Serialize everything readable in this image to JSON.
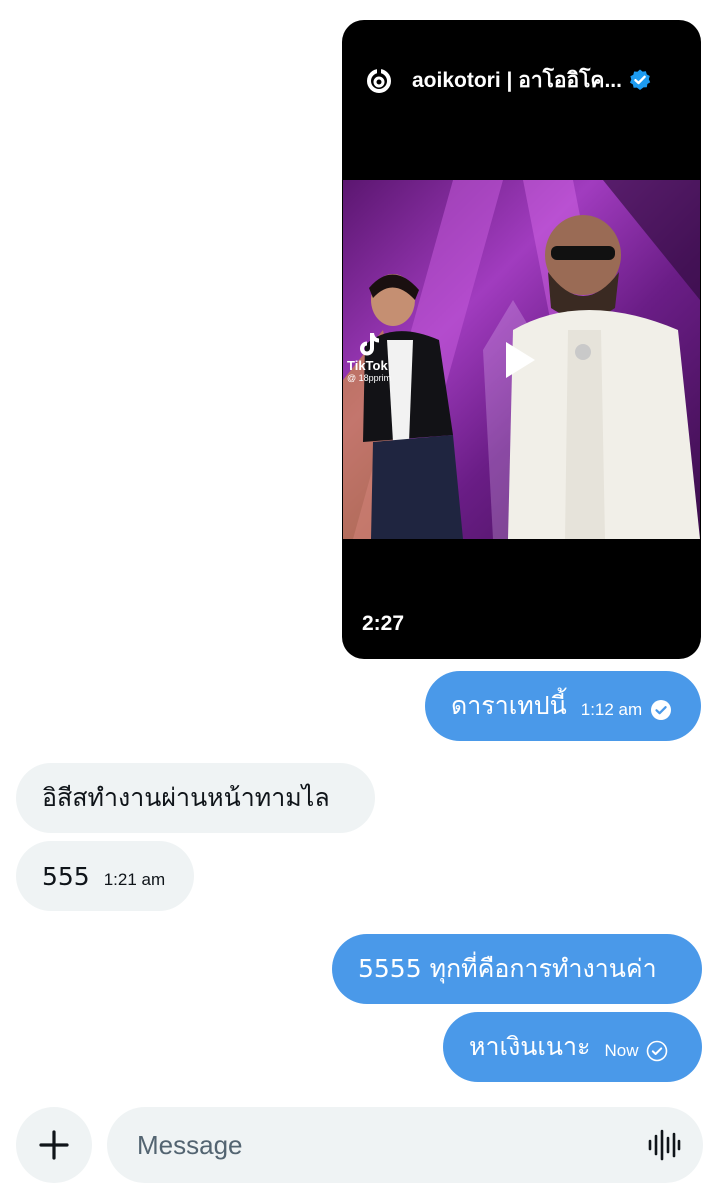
{
  "shared_post": {
    "author": "aoikotori | อาโออิโค...",
    "duration": "2:27",
    "watermark": {
      "brand": "TikTok",
      "handle": "@ 18pprim"
    },
    "icons": [
      "threads-logo-icon",
      "verified-badge-icon",
      "play-icon",
      "tiktok-icon"
    ]
  },
  "messages": [
    {
      "direction": "outgoing",
      "text": "ดาราเทปนี้",
      "time": "1:12 am",
      "status_icon": "sent-check-icon"
    },
    {
      "direction": "incoming",
      "text": "อิสีสทำงานผ่านหน้าทามไล",
      "time": ""
    },
    {
      "direction": "incoming",
      "text": "555",
      "time": "1:21 am"
    },
    {
      "direction": "outgoing",
      "text": "5555 ทุกที่คือการทำงานค่า",
      "time": ""
    },
    {
      "direction": "outgoing",
      "text": "หาเงินเนาะ",
      "time": "Now",
      "status_icon": "sent-check-icon"
    }
  ],
  "composer": {
    "placeholder": "Message",
    "value": "",
    "icons": [
      "plus-icon",
      "voice-message-icon"
    ]
  },
  "colors": {
    "outgoing_bubble": "#4a99e9",
    "incoming_bubble": "#eff3f4",
    "verified": "#1d9bf0",
    "video_background": "#000000"
  }
}
